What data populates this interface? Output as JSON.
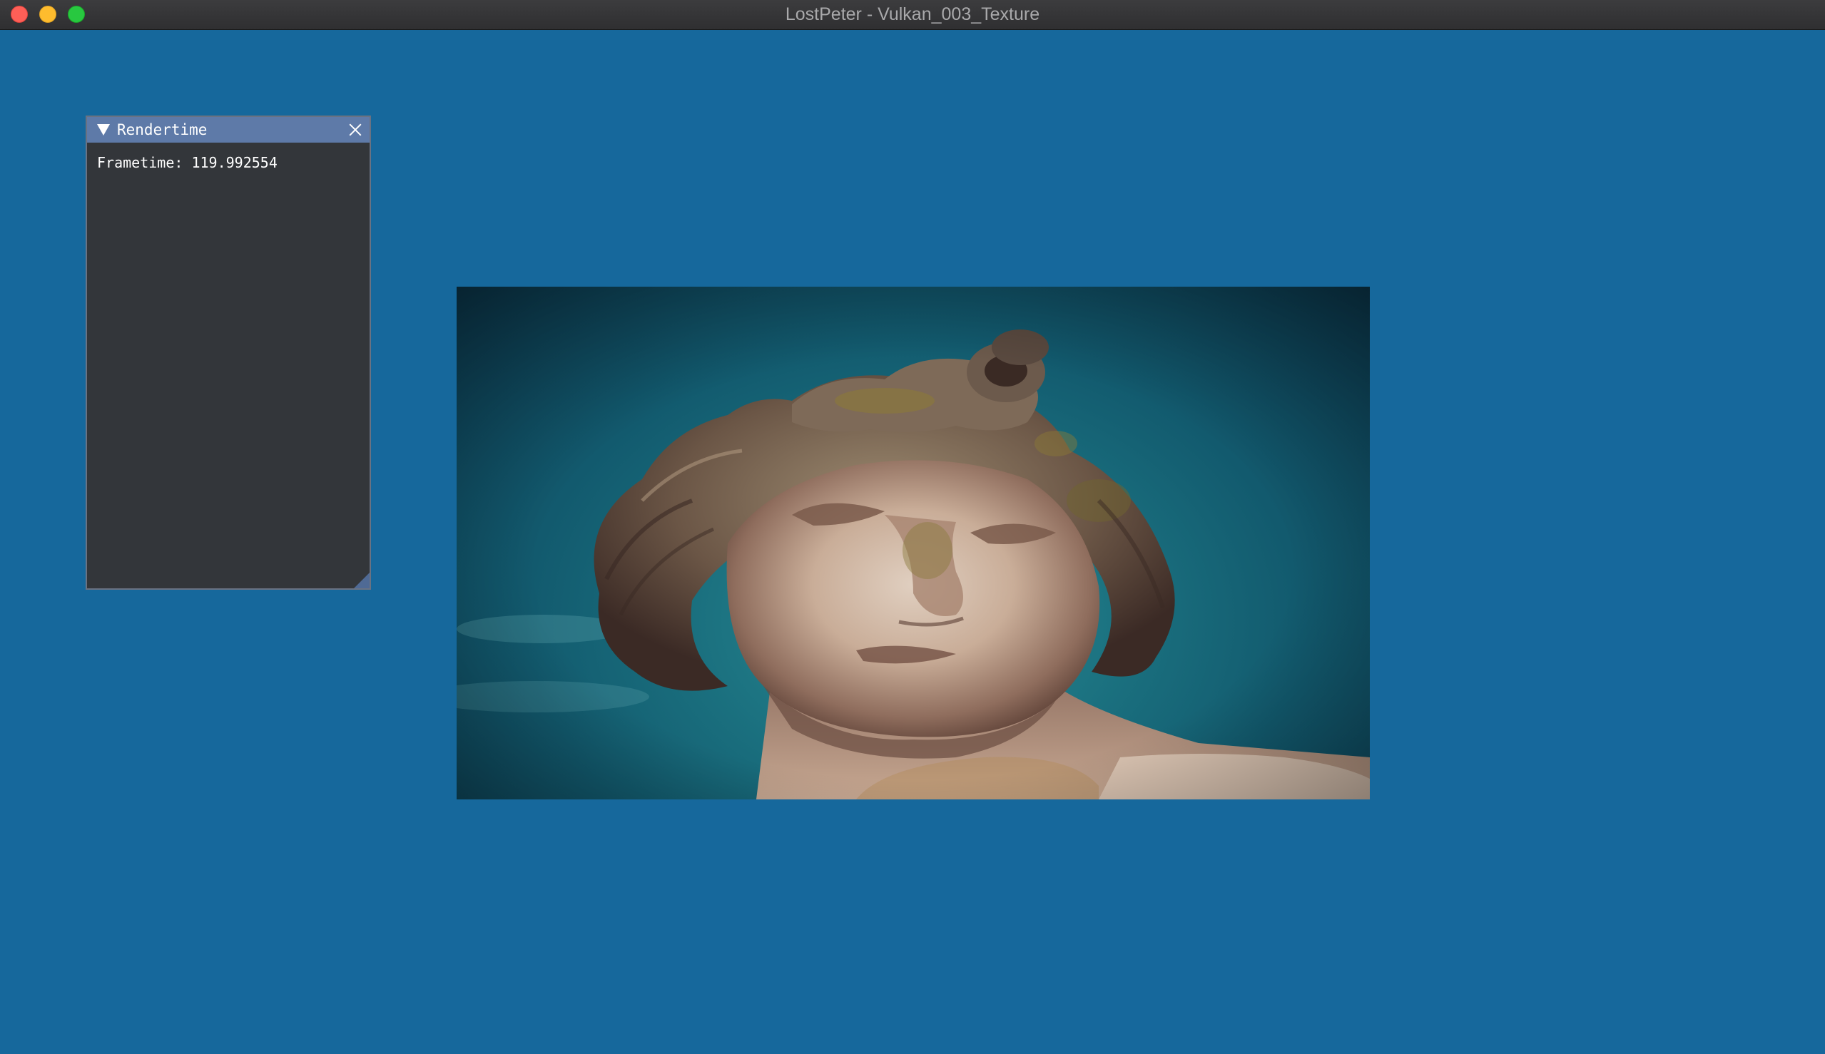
{
  "window": {
    "title": "LostPeter - Vulkan_003_Texture",
    "background_color": "#16689c"
  },
  "imgui_panel": {
    "title": "Rendertime",
    "frametime_text": "Frametime: 119.992554",
    "collapse_icon": "triangle-down-icon",
    "close_icon": "close-icon"
  },
  "texture": {
    "subject": "statue-head-image"
  }
}
